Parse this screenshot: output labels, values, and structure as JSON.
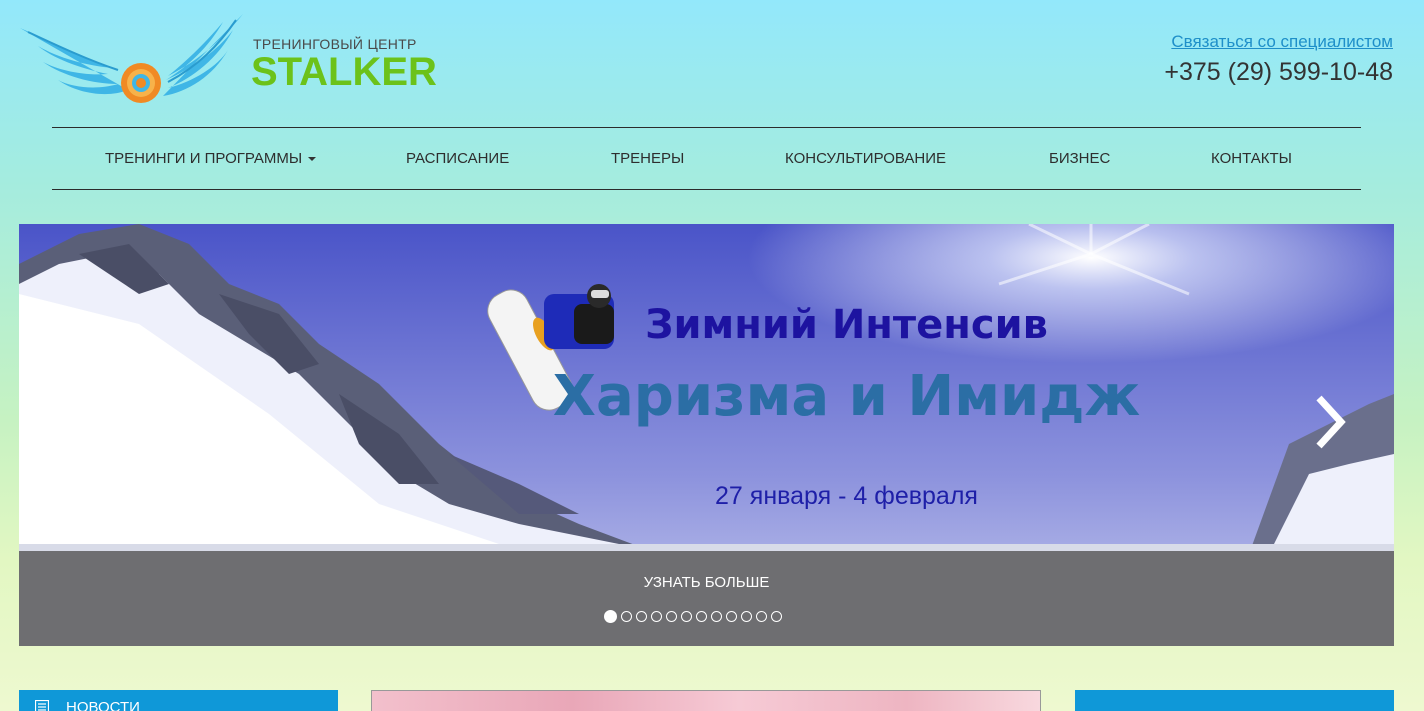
{
  "header": {
    "logo_subtitle": "ТРЕНИНГОВЫЙ ЦЕНТР",
    "logo_title": "STALKER",
    "contact_link": "Связаться со специалистом",
    "phone": "+375 (29) 599-10-48"
  },
  "nav": {
    "items": [
      {
        "label": "ТРЕНИНГИ И ПРОГРАММЫ",
        "has_dropdown": true
      },
      {
        "label": "РАСПИСАНИЕ"
      },
      {
        "label": "ТРЕНЕРЫ"
      },
      {
        "label": "КОНСУЛЬТИРОВАНИЕ"
      },
      {
        "label": "БИЗНЕС"
      },
      {
        "label": "КОНТАКТЫ"
      }
    ]
  },
  "carousel": {
    "slide_title": "Зимний Интенсив",
    "slide_subtitle": "Харизма и Имидж",
    "slide_dates": "27 января - 4 февраля",
    "cta_label": "УЗНАТЬ БОЛЬШЕ",
    "prev_icon": "chevron-left-icon",
    "next_icon": "chevron-right-icon",
    "slide_count": 12,
    "active_index": 0
  },
  "sections": {
    "news_label": "НОВОСТИ",
    "news_icon": "newspaper-icon"
  },
  "colors": {
    "brand_green": "#6cc21a",
    "accent_blue": "#0f98d8",
    "link_blue": "#1e8fc9"
  }
}
